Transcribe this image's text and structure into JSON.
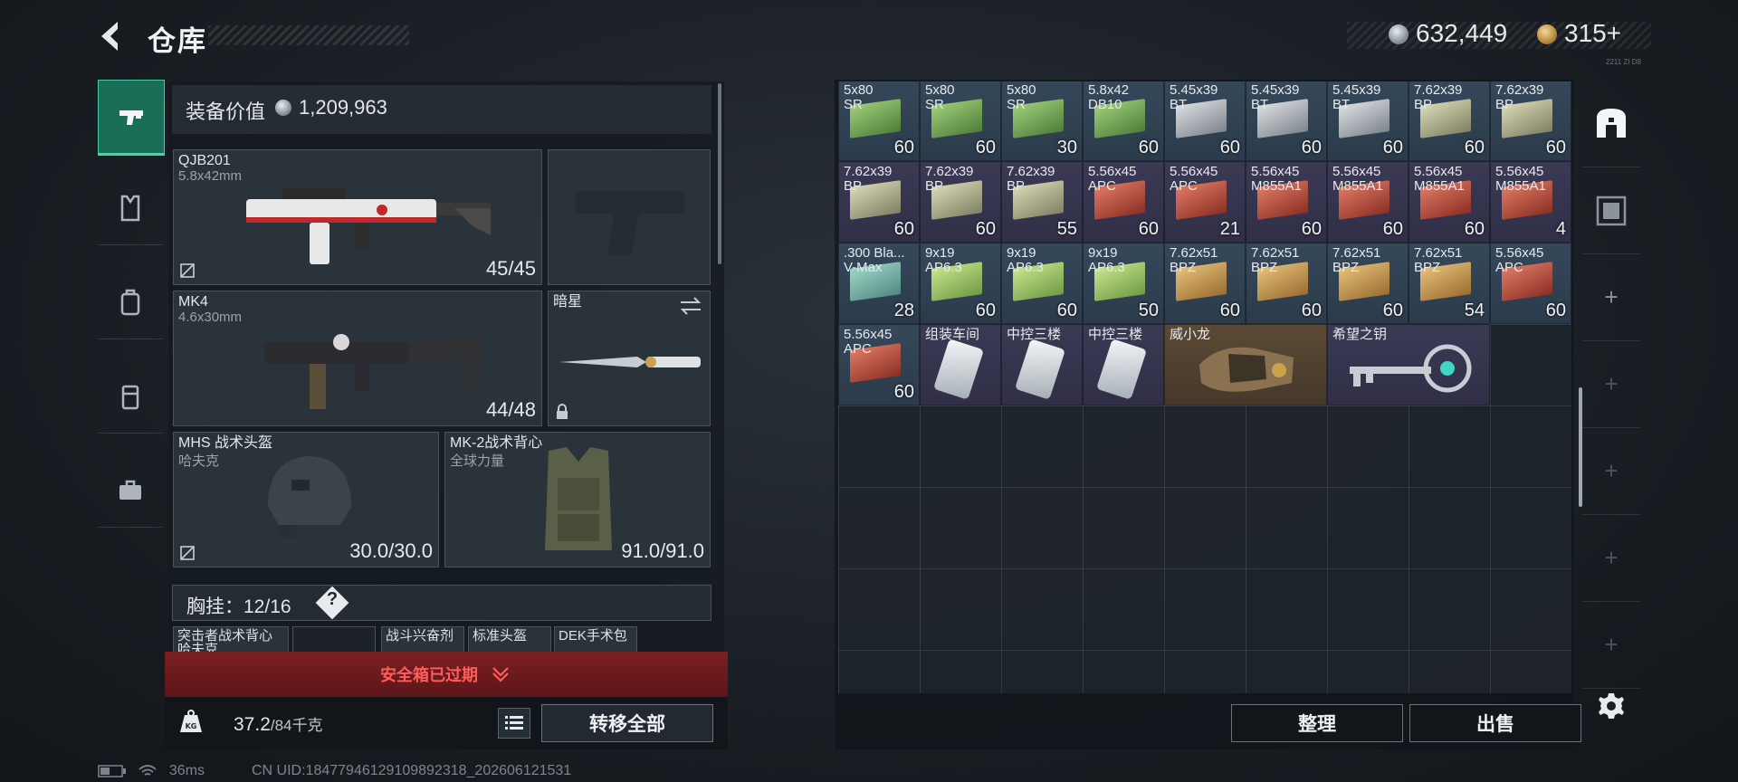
{
  "header": {
    "title": "仓库",
    "money_primary": "632,449",
    "money_secondary": "315+",
    "tiny_label": "2211 ZI D8"
  },
  "nav": {
    "items": [
      "pistol-icon",
      "gift-icon",
      "backpack-icon",
      "rig-icon",
      "briefcase-icon"
    ]
  },
  "equipment": {
    "label": "装备价值",
    "value": "1,209,963",
    "slots": [
      {
        "name": "QJB201",
        "sub": "5.8x42mm",
        "count": "45/45"
      },
      {
        "name": "",
        "sub": "",
        "count": ""
      },
      {
        "name": "MK4",
        "sub": "4.6x30mm",
        "count": "44/48"
      },
      {
        "name": "暗星",
        "sub": "",
        "count": ""
      },
      {
        "name": "MHS 战术头盔",
        "sub": "哈夫克",
        "count": "30.0/30.0"
      },
      {
        "name": "MK-2战术背心",
        "sub": "全球力量",
        "count": "91.0/91.0"
      }
    ],
    "rig_label": "胸挂：",
    "rig_capacity": "12/16",
    "rig_help": "?",
    "rig_items": [
      "突击者战术背心",
      "",
      "战斗兴奋剂",
      "标准头盔",
      "DEK手术包"
    ],
    "rig_item0_sub": "哈夫克"
  },
  "safe_box": {
    "text": "安全箱已过期"
  },
  "weight": {
    "current": "37.2",
    "suffix": "/84千克"
  },
  "buttons": {
    "transfer_all": "转移全部",
    "sort": "整理",
    "sell": "出售"
  },
  "status": {
    "ping": "36ms",
    "uid": "CN UID:18477946129109892318_202606121531"
  },
  "grid": {
    "rows": [
      [
        {
          "l1": "5x80",
          "l2": "SR",
          "q": "60",
          "box": "green",
          "c": "blue"
        },
        {
          "l1": "5x80",
          "l2": "SR",
          "q": "60",
          "box": "green",
          "c": "blue"
        },
        {
          "l1": "5x80",
          "l2": "SR",
          "q": "30",
          "box": "green",
          "c": "blue"
        },
        {
          "l1": "5.8x42",
          "l2": "DB10",
          "q": "60",
          "box": "green",
          "c": "blue"
        },
        {
          "l1": "5.45x39",
          "l2": "BT",
          "q": "60",
          "box": "silver",
          "c": "blue"
        },
        {
          "l1": "5.45x39",
          "l2": "BT",
          "q": "60",
          "box": "silver",
          "c": "blue"
        },
        {
          "l1": "5.45x39",
          "l2": "BT",
          "q": "60",
          "box": "silver",
          "c": "blue"
        },
        {
          "l1": "7.62x39",
          "l2": "BP",
          "q": "60",
          "box": "olive",
          "c": "blue"
        },
        {
          "l1": "7.62x39",
          "l2": "BP",
          "q": "60",
          "box": "olive",
          "c": "blue"
        }
      ],
      [
        {
          "l1": "7.62x39",
          "l2": "BP",
          "q": "60",
          "box": "olive",
          "c": "purple"
        },
        {
          "l1": "7.62x39",
          "l2": "BP",
          "q": "60",
          "box": "olive",
          "c": "purple"
        },
        {
          "l1": "7.62x39",
          "l2": "BP",
          "q": "55",
          "box": "olive",
          "c": "purple"
        },
        {
          "l1": "5.56x45",
          "l2": "APC",
          "q": "60",
          "box": "red",
          "c": "purple"
        },
        {
          "l1": "5.56x45",
          "l2": "APC",
          "q": "21",
          "box": "red",
          "c": "purple"
        },
        {
          "l1": "5.56x45",
          "l2": "M855A1",
          "q": "60",
          "box": "red",
          "c": "purple"
        },
        {
          "l1": "5.56x45",
          "l2": "M855A1",
          "q": "60",
          "box": "red",
          "c": "purple"
        },
        {
          "l1": "5.56x45",
          "l2": "M855A1",
          "q": "60",
          "box": "red",
          "c": "purple"
        },
        {
          "l1": "5.56x45",
          "l2": "M855A1",
          "q": "4",
          "box": "red",
          "c": "purple"
        }
      ],
      [
        {
          "l1": ".300 Bla...",
          "l2": "V-Max",
          "q": "28",
          "box": "teal",
          "c": "blue"
        },
        {
          "l1": "9x19",
          "l2": "AP6.3",
          "q": "60",
          "box": "lime",
          "c": "blue"
        },
        {
          "l1": "9x19",
          "l2": "AP6.3",
          "q": "60",
          "box": "lime",
          "c": "blue"
        },
        {
          "l1": "9x19",
          "l2": "AP6.3",
          "q": "50",
          "box": "lime",
          "c": "blue"
        },
        {
          "l1": "7.62x51",
          "l2": "BPZ",
          "q": "60",
          "box": "tan",
          "c": "blue"
        },
        {
          "l1": "7.62x51",
          "l2": "BPZ",
          "q": "60",
          "box": "tan",
          "c": "blue"
        },
        {
          "l1": "7.62x51",
          "l2": "BPZ",
          "q": "60",
          "box": "tan",
          "c": "blue"
        },
        {
          "l1": "7.62x51",
          "l2": "BPZ",
          "q": "54",
          "box": "tan",
          "c": "blue"
        },
        {
          "l1": "5.56x45",
          "l2": "APC",
          "q": "60",
          "box": "red",
          "c": "blue"
        }
      ]
    ],
    "row4": [
      {
        "l1": "5.56x45",
        "l2": "APC",
        "q": "60",
        "box": "red",
        "c": "blue",
        "w": 1
      },
      {
        "l1": "组装车间",
        "l2": "",
        "q": "",
        "card": true,
        "c": "purple",
        "w": 1
      },
      {
        "l1": "中控三楼",
        "l2": "",
        "q": "",
        "card": true,
        "c": "purple",
        "w": 1
      },
      {
        "l1": "中控三楼",
        "l2": "",
        "q": "",
        "card": true,
        "c": "purple",
        "w": 1
      },
      {
        "l1": "威小龙",
        "l2": "",
        "q": "",
        "c": "gold",
        "w": 2,
        "item": "glove"
      },
      {
        "l1": "希望之钥",
        "l2": "",
        "q": "",
        "c": "purple",
        "w": 2,
        "item": "key"
      }
    ]
  },
  "colors": {
    "accent_green": "#1a6e57",
    "expired_red": "#ff5c5c",
    "rarity_blue": "#35485a",
    "rarity_purple": "#3b3a55",
    "rarity_gold": "#5a4a35"
  }
}
